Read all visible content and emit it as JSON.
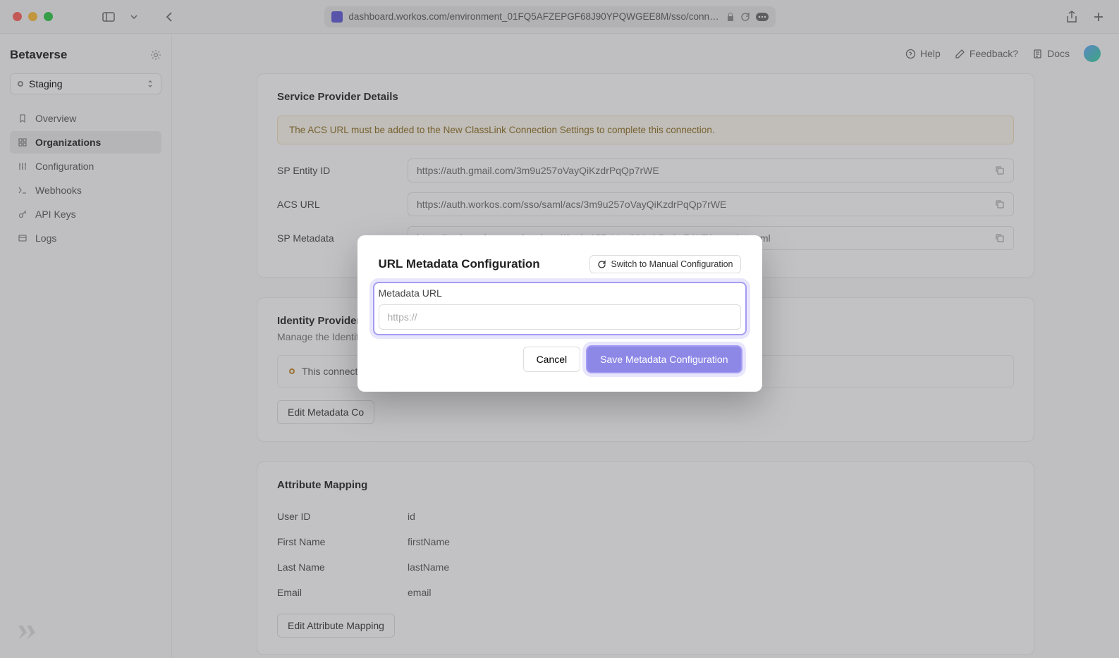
{
  "browser": {
    "url": "dashboard.workos.com/environment_01FQ5AFZEPGF68J90YPQWGEE8M/sso/connectio"
  },
  "sidebar": {
    "org_name": "Betaverse",
    "env_label": "Staging",
    "items": [
      {
        "label": "Overview"
      },
      {
        "label": "Organizations"
      },
      {
        "label": "Configuration"
      },
      {
        "label": "Webhooks"
      },
      {
        "label": "API Keys"
      },
      {
        "label": "Logs"
      }
    ]
  },
  "topbar": {
    "help": "Help",
    "feedback": "Feedback?",
    "docs": "Docs"
  },
  "sp": {
    "title": "Service Provider Details",
    "warning": "The ACS URL must be added to the New ClassLink Connection Settings to complete this connection.",
    "rows": [
      {
        "label": "SP Entity ID",
        "value": "https://auth.gmail.com/3m9u257oVayQiKzdrPqQp7rWE"
      },
      {
        "label": "ACS URL",
        "value": "https://auth.workos.com/sso/saml/acs/3m9u257oVayQiKzdrPqQp7rWE"
      },
      {
        "label": "SP Metadata",
        "value": "https://auth.workos.com/sso/saml/3m9u257oVayQiKzdrPqQp7rWE/metadata.xml"
      }
    ]
  },
  "idp": {
    "title": "Identity Provider C",
    "subtitle": "Manage the Identit",
    "status": "This connecti",
    "button": "Edit Metadata Co"
  },
  "attrs": {
    "title": "Attribute Mapping",
    "rows": [
      {
        "label": "User ID",
        "value": "id"
      },
      {
        "label": "First Name",
        "value": "firstName"
      },
      {
        "label": "Last Name",
        "value": "lastName"
      },
      {
        "label": "Email",
        "value": "email"
      }
    ],
    "button": "Edit Attribute Mapping"
  },
  "modal": {
    "title": "URL Metadata Configuration",
    "switch": "Switch to Manual Configuration",
    "input_label": "Metadata URL",
    "placeholder": "https://",
    "cancel": "Cancel",
    "save": "Save Metadata Configuration"
  }
}
